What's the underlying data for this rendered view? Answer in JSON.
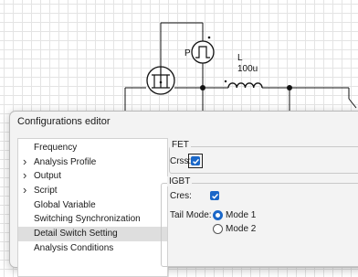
{
  "schematic": {
    "inductor_name": "L",
    "inductor_value": "100u",
    "source_label": "P"
  },
  "dialog": {
    "title": "Configurations editor",
    "tree": [
      {
        "label": "Frequency",
        "expandable": false,
        "selected": false
      },
      {
        "label": "Analysis Profile",
        "expandable": true,
        "selected": false
      },
      {
        "label": "Output",
        "expandable": true,
        "selected": false
      },
      {
        "label": "Script",
        "expandable": true,
        "selected": false
      },
      {
        "label": "Global Variable",
        "expandable": false,
        "selected": false
      },
      {
        "label": "Switching Synchronization",
        "expandable": false,
        "selected": false
      },
      {
        "label": "Detail Switch Setting",
        "expandable": false,
        "selected": true
      },
      {
        "label": "Analysis Conditions",
        "expandable": false,
        "selected": false
      }
    ],
    "fet": {
      "title": "FET",
      "crss_label": "Crss:",
      "crss_checked": true
    },
    "igbt": {
      "title": "IGBT",
      "cres_label": "Cres:",
      "cres_checked": true,
      "tail_mode_label": "Tail Mode:",
      "mode_options": [
        "Mode 1",
        "Mode 2"
      ],
      "selected_mode": "Mode 1"
    }
  },
  "colors": {
    "accent": "#1a67c8",
    "wire": "#111111",
    "selection": "#dedede"
  }
}
